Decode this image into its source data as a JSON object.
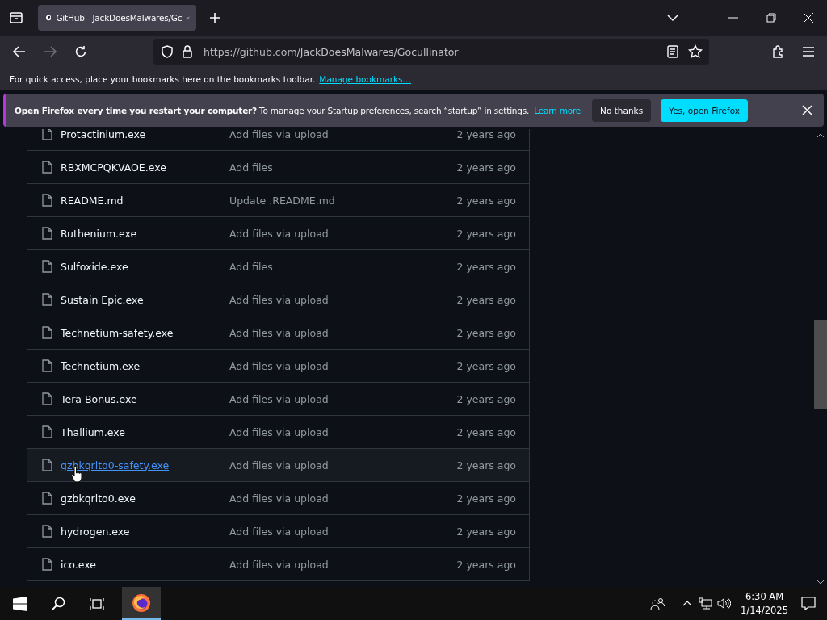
{
  "browser": {
    "tab": {
      "title": "GitHub - JackDoesMalwares/Gc",
      "selected": true
    },
    "url_host": "https://github.com",
    "url_path": "/JackDoesMalwares/Gocullinator"
  },
  "bookmarks_bar": {
    "text": "For quick access, place your bookmarks here on the bookmarks toolbar.",
    "link": "Manage bookmarks…"
  },
  "notification": {
    "title": "Open Firefox every time you restart your computer?",
    "text": "To manage your Startup preferences, search “startup” in settings.",
    "link": "Learn more",
    "buttons": [
      {
        "label": "No thanks",
        "kind": "secondary"
      },
      {
        "label": "Yes, open Firefox",
        "kind": "primary"
      }
    ]
  },
  "files": [
    {
      "name": "Protactinium.exe",
      "commit": "Add files via upload",
      "age": "2 years ago",
      "hovered": false
    },
    {
      "name": "RBXMCPQKVAOE.exe",
      "commit": "Add files",
      "age": "2 years ago",
      "hovered": false
    },
    {
      "name": "README.md",
      "commit": "Update .README.md",
      "age": "2 years ago",
      "hovered": false
    },
    {
      "name": "Ruthenium.exe",
      "commit": "Add files via upload",
      "age": "2 years ago",
      "hovered": false
    },
    {
      "name": "Sulfoxide.exe",
      "commit": "Add files",
      "age": "2 years ago",
      "hovered": false
    },
    {
      "name": "Sustain Epic.exe",
      "commit": "Add files via upload",
      "age": "2 years ago",
      "hovered": false
    },
    {
      "name": "Technetium-safety.exe",
      "commit": "Add files via upload",
      "age": "2 years ago",
      "hovered": false
    },
    {
      "name": "Technetium.exe",
      "commit": "Add files via upload",
      "age": "2 years ago",
      "hovered": false
    },
    {
      "name": "Tera Bonus.exe",
      "commit": "Add files via upload",
      "age": "2 years ago",
      "hovered": false
    },
    {
      "name": "Thallium.exe",
      "commit": "Add files via upload",
      "age": "2 years ago",
      "hovered": false
    },
    {
      "name": "gzbkqrlto0-safety.exe",
      "commit": "Add files via upload",
      "age": "2 years ago",
      "hovered": true
    },
    {
      "name": "gzbkqrlto0.exe",
      "commit": "Add files via upload",
      "age": "2 years ago",
      "hovered": false
    },
    {
      "name": "hydrogen.exe",
      "commit": "Add files via upload",
      "age": "2 years ago",
      "hovered": false
    },
    {
      "name": "ico.exe",
      "commit": "Add files via upload",
      "age": "2 years ago",
      "hovered": false
    }
  ],
  "taskbar": {
    "time": "6:30 AM",
    "date": "1/14/2025",
    "firefox_active": true
  }
}
